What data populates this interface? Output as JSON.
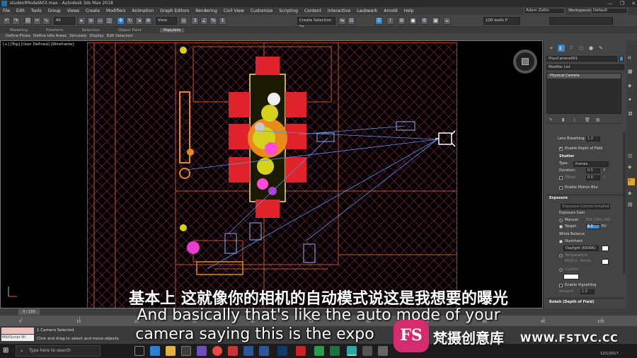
{
  "window": {
    "title": "studentModelA03.max - Autodesk 3ds Max 2018",
    "controls": [
      "—",
      "❐",
      "✕"
    ]
  },
  "menu": {
    "items": [
      "File",
      "Edit",
      "Tools",
      "Group",
      "Views",
      "Create",
      "Modifiers",
      "Animation",
      "Graph Editors",
      "Rendering",
      "Civil View",
      "Customize",
      "Scripting",
      "Content",
      "Interactive",
      "Laubwerk",
      "Arnold",
      "Help"
    ],
    "user": "Adam Zollin",
    "workspace_label": "Workspaces:",
    "workspace_value": "Default"
  },
  "toolbar": {
    "filter": "All",
    "view": "View",
    "selection_set": "Create Selection Se",
    "walls_field": "100 walls P"
  },
  "ribbon": {
    "tabs": [
      "Modeling",
      "Freeform",
      "Selection",
      "Object Paint",
      "Populate"
    ],
    "active_tab": "Populate",
    "sub_items": [
      "Define Flows",
      "Define Idle Areas",
      "Simulate",
      "Display",
      "Edit Selected"
    ]
  },
  "viewport": {
    "label": "[+] [Top] [User Defined] [Wireframe]"
  },
  "command_panel": {
    "object_name": "PhysCamera001",
    "modifier_list": "Modifier List",
    "stack_item": "Physical Camera",
    "lens_breathing_label": "Lens Breathing:",
    "lens_breathing_value": "1.0",
    "enable_dof": "Enable Depth of Field",
    "shutter_header": "Shutter",
    "type_label": "Type:",
    "type_value": "frames",
    "duration_label": "Duration:",
    "duration_value": "0.5",
    "duration_unit": "f",
    "offset_label": "Offset:",
    "offset_value": "0.0",
    "offset_unit": "f",
    "enable_motion_blur": "Enable Motion Blur",
    "exposure_header": "Exposure",
    "exposure_control_btn": "Exposure Control Installed",
    "exposure_gain": "Exposure Gain",
    "manual_label": "Manual:",
    "manual_value": "ISO 100",
    "manual_value2": "1.250",
    "target_label": "Target:",
    "target_value": "6.0",
    "target_unit": "EV",
    "white_balance": "White Balance",
    "illuminant_label": "Illuminant",
    "illuminant_value": "Daylight (6500K)",
    "temperature_label": "Temperature",
    "temperature_value": "6500.0",
    "temperature_unit": "Kelvin",
    "custom_label": "Custom",
    "enable_vignetting": "Enable Vignetting",
    "amount_label": "Amount:",
    "amount_value": "1.0",
    "bokeh_header": "Bokeh (Depth of Field)"
  },
  "timeline": {
    "frame_display": "0 / 100",
    "ticks": [
      "0",
      "10",
      "20",
      "30",
      "40",
      "50",
      "60",
      "70",
      "80",
      "90",
      "100"
    ]
  },
  "status": {
    "selection": "1 Camera Selected",
    "prompt": "Click and drag to select and move objects",
    "maxscript_label": "MAXScript Mi"
  },
  "subtitles": {
    "chinese": "基本上 这就像你的相机的自动模式说这是我想要的曝光",
    "english_line1": "And basically that's like the auto mode of your",
    "english_line2": "camera saying this is the expo"
  },
  "taskbar": {
    "search_placeholder": "Type here to search",
    "date": "12/1/2017"
  },
  "watermark": {
    "logo_text": "FS",
    "brand_cn": "梵摄创意库",
    "url": "WWW.FSTVC.CC"
  }
}
